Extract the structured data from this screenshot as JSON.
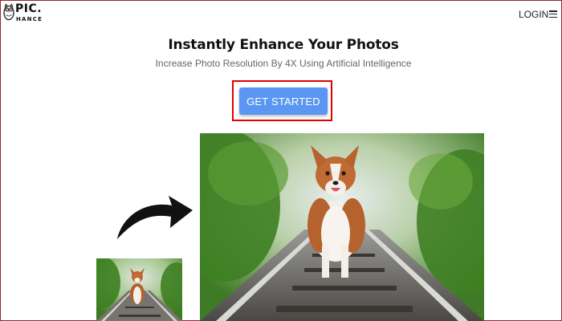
{
  "header": {
    "logo": {
      "main": "PIC.",
      "sub": "HANCE",
      "icon": "owl-icon"
    },
    "login_label": "LOGIN",
    "menu_icon": "hamburger-menu-icon"
  },
  "hero": {
    "title": "Instantly Enhance Your Photos",
    "subtitle": "Increase Photo Resolution By 4X Using Artificial Intelligence",
    "cta_label": "GET STARTED"
  },
  "images": {
    "large": "corgi-on-railway-enhanced-image",
    "small": "corgi-on-railway-original-image",
    "arrow": "curved-arrow-icon"
  },
  "colors": {
    "cta_background": "#5b97f2",
    "highlight_outline": "#e00000",
    "frame_border": "#8b2d2d"
  }
}
